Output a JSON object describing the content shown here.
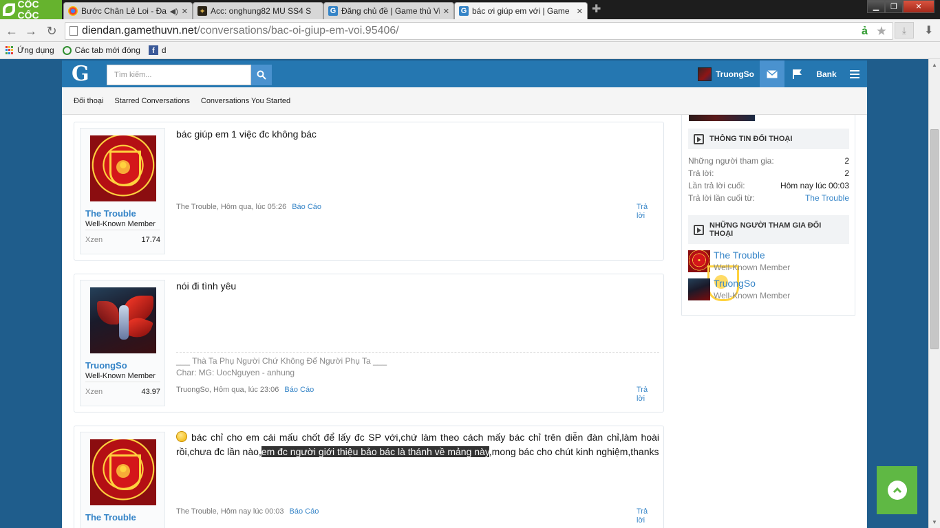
{
  "browser": {
    "brand": "CỐC CỐC",
    "tabs": [
      {
        "title": "Bước Chân Lẻ Loi - Đan",
        "active": false
      },
      {
        "title": "Acc: onghung82 MU SS4 S",
        "active": false
      },
      {
        "title": "Đăng chủ đề | Game thủ Vi",
        "active": false
      },
      {
        "title": "bác ơi giúp em với | Game",
        "active": true
      }
    ],
    "url_host": "diendan.gamethuvn.net",
    "url_path": "/conversations/bac-oi-giup-em-voi.95406/",
    "bookmarks": [
      {
        "label": "Ứng dụng"
      },
      {
        "label": "Các tab mới đóng"
      },
      {
        "label": "d"
      }
    ],
    "colors": {
      "brand_green": "#66b32e",
      "tab_bar": "#1d1d1d"
    }
  },
  "site": {
    "logo": "G",
    "search_placeholder": "Tìm kiếm...",
    "user": "TruongSo",
    "bank_label": "Bank",
    "subnav": [
      "Đối thoại",
      "Starred Conversations",
      "Conversations You Started"
    ],
    "colors": {
      "header_blue": "#2577b1",
      "link_blue": "#3584c7",
      "active_nav": "#4a92cf",
      "page_bg": "#1f5d8c"
    }
  },
  "messages": [
    {
      "author": "The Trouble",
      "title": "Well-Known Member",
      "stat_label": "Xzen",
      "stat_value": "17.74",
      "text": "bác giúp em 1 việc đc không bác",
      "meta": "The Trouble, Hôm qua, lúc 05:26",
      "report": "Báo Cáo",
      "reply": "Trả lời"
    },
    {
      "author": "TruongSo",
      "title": "Well-Known Member",
      "stat_label": "Xzen",
      "stat_value": "43.97",
      "text": "nói đi tình yêu",
      "signature_1": "___ Thà Ta Phụ Người Chứ Không Để Người Phụ Ta ___",
      "signature_2": "Char: MG: UocNguyen - anhung",
      "meta": "TruongSo, Hôm qua, lúc 23:06",
      "report": "Báo Cáo",
      "reply": "Trả lời"
    },
    {
      "author": "The Trouble",
      "text_before": "bác chỉ cho em cái mấu chốt để lấy đc SP với,chứ làm theo cách mấy bác chỉ trên diễn đàn chỉ,làm hoài rồi,chưa đc lần nào,",
      "text_highlight": "em đc người giới thiệu bảo bác là thánh về mảng này",
      "text_after": ",mong bác cho chút kinh nghiệm,thanks",
      "meta": "The Trouble, Hôm nay lúc 00:03",
      "report": "Báo Cáo",
      "reply": "Trả lời"
    }
  ],
  "sidebar": {
    "info_title": "THÔNG TIN ĐỐI THOẠI",
    "rows": [
      {
        "label": "Những người tham gia:",
        "value": "2"
      },
      {
        "label": "Trả lời:",
        "value": "2"
      },
      {
        "label": "Lần trả lời cuối:",
        "value": "Hôm nay lúc 00:03"
      },
      {
        "label": "Trả lời lần cuối từ:",
        "value": "The Trouble"
      }
    ],
    "participants_title": "NHỮNG NGƯỜI THAM GIA ĐỐI THOẠI",
    "participants": [
      {
        "name": "The Trouble",
        "title": "Well-Known Member"
      },
      {
        "name": "TruongSo",
        "title": "Well-Known Member"
      }
    ]
  }
}
